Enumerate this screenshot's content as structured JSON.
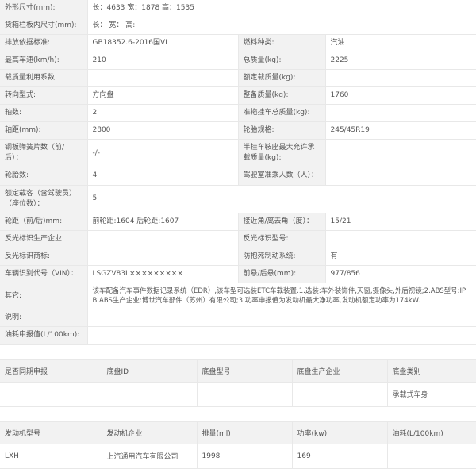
{
  "spec_rows": [
    {
      "full": true,
      "label": "外形尺寸(mm):",
      "value": "长：4633 宽：1878 高：1535"
    },
    {
      "full": true,
      "label": "货箱栏板内尺寸(mm):",
      "value": "长： 宽： 高:"
    },
    {
      "full": false,
      "label_l": "排放依据标准:",
      "value_l": "GB18352.6-2016国VI",
      "label_r": "燃料种类:",
      "value_r": "汽油"
    },
    {
      "full": false,
      "label_l": "最高车速(km/h):",
      "value_l": "210",
      "label_r": "总质量(kg):",
      "value_r": "2225"
    },
    {
      "full": false,
      "label_l": "载质量利用系数:",
      "value_l": "",
      "label_r": "额定载质量(kg):",
      "value_r": ""
    },
    {
      "full": false,
      "label_l": "转向型式:",
      "value_l": "方向盘",
      "label_r": "整备质量(kg):",
      "value_r": "1760"
    },
    {
      "full": false,
      "label_l": "轴数:",
      "value_l": "2",
      "label_r": "准拖挂车总质量(kg):",
      "value_r": ""
    },
    {
      "full": false,
      "label_l": "轴距(mm):",
      "value_l": "2800",
      "label_r": "轮胎规格:",
      "value_r": "245/45R19"
    },
    {
      "full": false,
      "label_l": "钢板弹簧片数（前/后）：",
      "value_l": "-/-",
      "label_r": "半挂车鞍座最大允许承载质量(kg):",
      "value_r": ""
    },
    {
      "full": false,
      "label_l": "轮胎数:",
      "value_l": "4",
      "label_r": "驾驶室准乘人数（人）：",
      "value_r": ""
    },
    {
      "full": true,
      "label": "额定载客（含驾驶员）（座位数）：",
      "value": "5"
    },
    {
      "full": false,
      "label_l": "轮距（前/后)mm:",
      "value_l": "前轮距:1604 后轮距:1607",
      "label_r": "接近角/离去角（度）：",
      "value_r": "15/21"
    },
    {
      "full": false,
      "label_l": "反光标识生产企业:",
      "value_l": "",
      "label_r": "反光标识型号:",
      "value_r": ""
    },
    {
      "full": false,
      "label_l": "反光标识商标:",
      "value_l": "",
      "label_r": "防抱死制动系统:",
      "value_r": "有"
    },
    {
      "full": false,
      "label_l": "车辆识别代号（VIN）：",
      "value_l": "LSGZV83L×××××××××",
      "label_r": "前悬/后悬(mm):",
      "value_r": "977/856"
    },
    {
      "full": true,
      "notes": true,
      "label": "其它:",
      "value": "该车配备汽车事件数据记录系统（EDR）,该车型可选装ETC车载装置.1.选装:车外装饰件,天窗,摄像头,外后视镜;2.ABS型号:IPB,ABS生产企业:博世汽车部件（苏州）有限公司;3.功率申报值为发动机最大净功率,发动机额定功率为174kW."
    },
    {
      "full": true,
      "label": "说明:",
      "value": ""
    },
    {
      "full": true,
      "label": "油耗申报值(L/100km):",
      "value": ""
    }
  ],
  "chassis_table": {
    "headers": [
      "是否同期申报",
      "底盘ID",
      "底盘型号",
      "底盘生产企业",
      "底盘类别"
    ],
    "rows": [
      [
        "",
        "",
        "",
        "",
        "承载式车身"
      ]
    ]
  },
  "engine_table": {
    "headers": [
      "发动机型号",
      "发动机企业",
      "排量(ml)",
      "功率(kw)",
      "油耗(L/100km)"
    ],
    "rows": [
      [
        "LXH",
        "上汽通用汽车有限公司",
        "1998",
        "169",
        ""
      ]
    ]
  }
}
